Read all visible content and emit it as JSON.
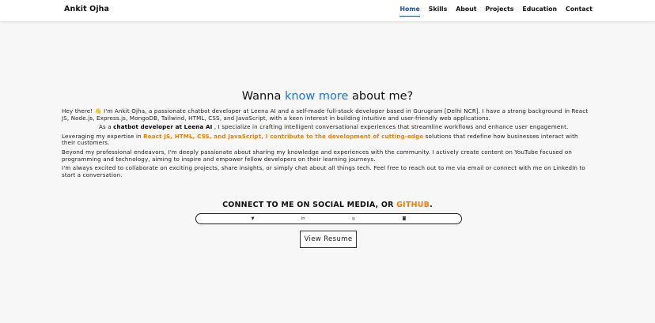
{
  "nav": {
    "brand": "Ankit Ojha",
    "links": [
      "Home",
      "Skills",
      "About",
      "Projects",
      "Education",
      "Contact"
    ]
  },
  "headline": {
    "pre": "Wanna ",
    "accent": "know more",
    "post": " about me?"
  },
  "about": {
    "p1": "Hey there! 👋 I'm Ankit Ojha, a passionate chatbot developer at Leena AI and a self-made full-stack developer based in Gurugram [Delhi NCR]. I have a strong background in React JS, Node.js, Express.js, MongoDB, Tailwind, HTML, CSS, and JavaScript, with a keen interest in building intuitive and user-friendly web applications.",
    "p2_pre": "As a ",
    "p2_bold": "chatbot developer at Leena AI",
    "p2_post": " , I specialize in crafting intelligent conversational experiences that streamline workflows and enhance user engagement.",
    "p3_pre": "Leveraging my expertise in ",
    "p3_orange": "React JS, HTML, CSS, and JavaScript, I contribute to the development of cutting-edge",
    "p3_post": " solutions that redefine how businesses interact with their customers.",
    "p4": "Beyond my professional endeavors, I'm deeply passionate about sharing my knowledge and experiences with the community. I actively create content on YouTube focused on programming and technology, aiming to inspire and empower fellow developers on their learning journeys.",
    "p5": "I'm always excited to collaborate on exciting projects, share insights, or simply chat about all things tech. Feel free to reach out to me via email or connect with me on LinkedIn to start a conversation."
  },
  "connect": {
    "pre": "CONNECT TO ME ON SOCIAL MEDIA, OR ",
    "accent": "GITHUB",
    "post": "."
  },
  "social": {
    "icons": [
      "twitter-icon",
      "linkedin-icon",
      "github-icon",
      "instagram-icon"
    ],
    "glyphs": [
      "▼",
      "in",
      "◎",
      "◙"
    ]
  },
  "resume_button": "View Resume",
  "colors": {
    "accent_blue": "#1a73e8",
    "accent_orange": "#f57c00",
    "nav_active": "#1f4fa3"
  }
}
